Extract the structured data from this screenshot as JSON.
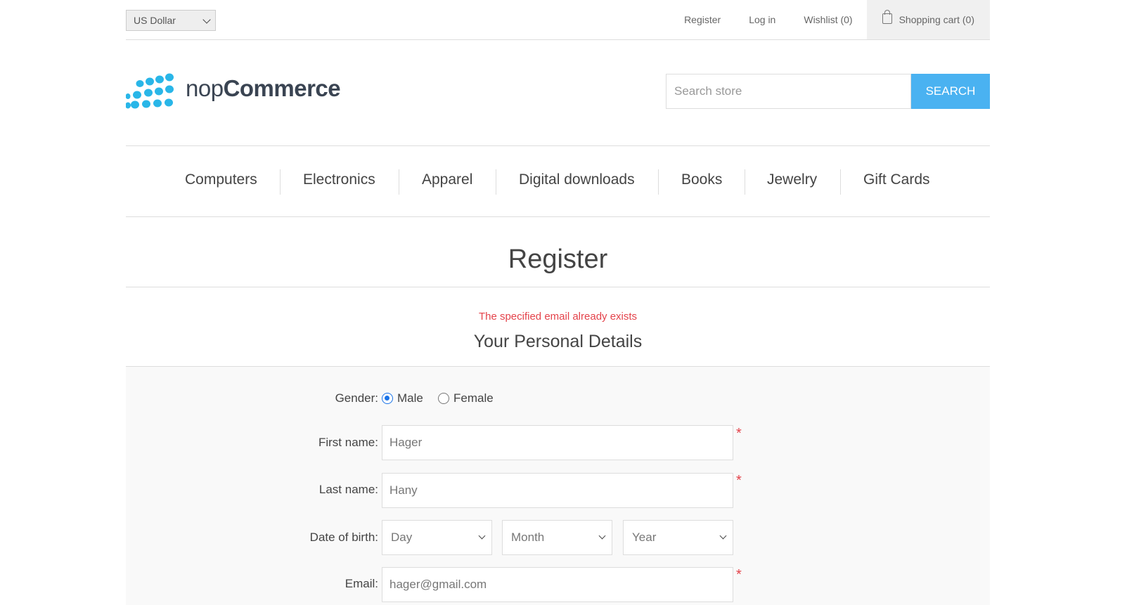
{
  "header": {
    "currency": "US Dollar",
    "links": {
      "register": "Register",
      "login": "Log in",
      "wishlist": "Wishlist (0)",
      "cart": "Shopping cart (0)"
    }
  },
  "logo": {
    "prefix": "nop",
    "suffix": "Commerce",
    "dot_color": "#29b6e8"
  },
  "search": {
    "placeholder": "Search store",
    "button": "SEARCH",
    "button_color": "#4ab2f1"
  },
  "menu": [
    "Computers",
    "Electronics",
    "Apparel",
    "Digital downloads",
    "Books",
    "Jewelry",
    "Gift Cards"
  ],
  "page": {
    "title": "Register",
    "error": "The specified email already exists",
    "section_title": "Your Personal Details"
  },
  "form": {
    "gender": {
      "label": "Gender:",
      "options": [
        "Male",
        "Female"
      ],
      "selected": "Male"
    },
    "first_name": {
      "label": "First name:",
      "value": "Hager"
    },
    "last_name": {
      "label": "Last name:",
      "value": "Hany"
    },
    "dob": {
      "label": "Date of birth:",
      "day": "Day",
      "month": "Month",
      "year": "Year"
    },
    "email": {
      "label": "Email:",
      "value": "hager@gmail.com"
    },
    "required_mark": "*"
  },
  "colors": {
    "error": "#e4434b",
    "accent": "#4ab2f1"
  }
}
